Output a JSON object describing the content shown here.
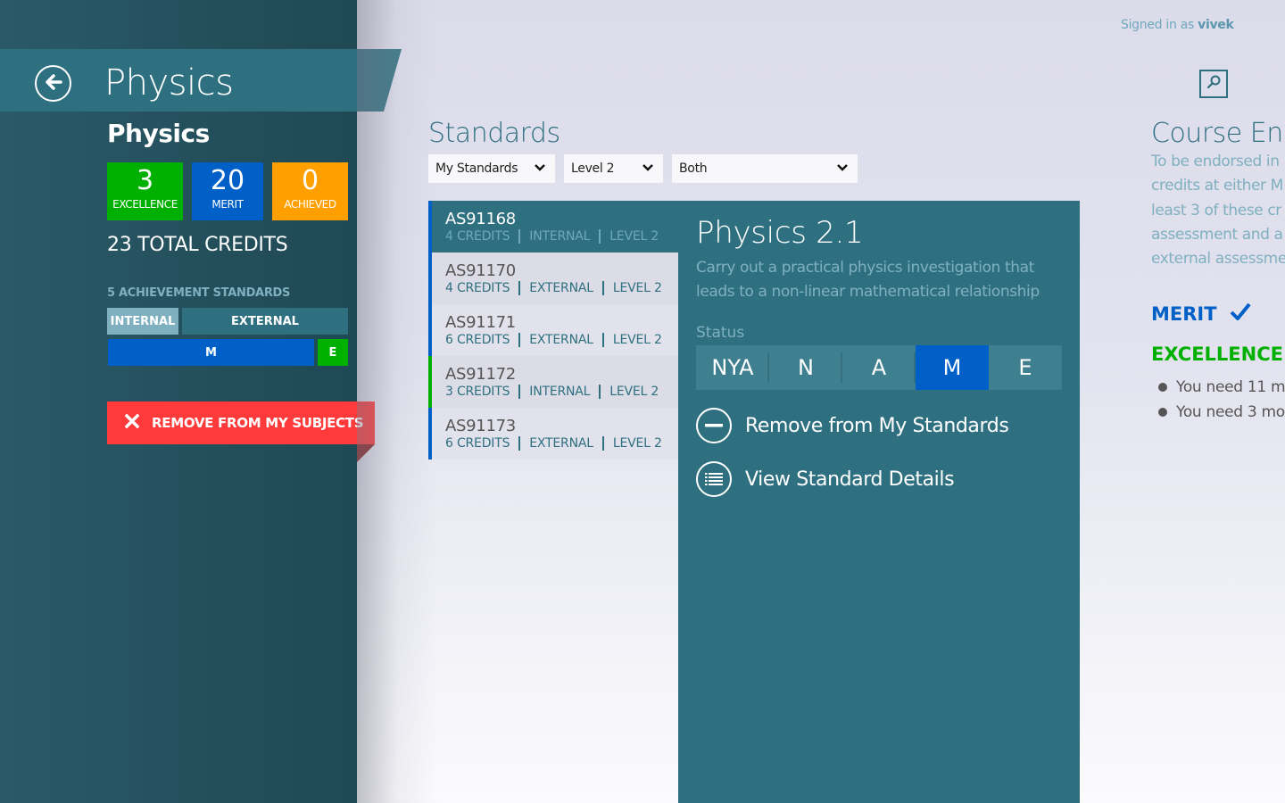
{
  "header": {
    "signed_in_prefix": "Signed in as",
    "username": "vivek",
    "search_icon": "search-icon"
  },
  "sidebar": {
    "banner_title": "Physics",
    "back_icon": "arrow-left-circle-icon",
    "subject_name": "Physics",
    "tiles": [
      {
        "value": "3",
        "label": "EXCELLENCE",
        "color": "#00b000"
      },
      {
        "value": "20",
        "label": "MERIT",
        "color": "#0060c8"
      },
      {
        "value": "0",
        "label": "ACHIEVED",
        "color": "#ff9f00"
      }
    ],
    "total_credits": "23 TOTAL CREDITS",
    "achievement_label": "5 ACHIEVEMENT STANDARDS",
    "type_bar": [
      {
        "label": "INTERNAL",
        "color": "#7fb0c0"
      },
      {
        "label": "EXTERNAL",
        "color": "#2f7080"
      }
    ],
    "grade_bar": [
      {
        "label": "M",
        "color": "#0060c8"
      },
      {
        "label": "E",
        "color": "#00b000"
      }
    ],
    "remove_button": "REMOVE FROM MY SUBJECTS",
    "remove_color": "#ff3a3a"
  },
  "standards": {
    "title": "Standards",
    "filters": [
      {
        "value": "My Standards"
      },
      {
        "value": "Level 2"
      },
      {
        "value": "Both"
      }
    ],
    "items": [
      {
        "code": "AS91168",
        "credits": "4 CREDITS",
        "type": "INTERNAL",
        "level": "LEVEL 2",
        "selected": true
      },
      {
        "code": "AS91170",
        "credits": "4 CREDITS",
        "type": "EXTERNAL",
        "level": "LEVEL 2"
      },
      {
        "code": "AS91171",
        "credits": "6 CREDITS",
        "type": "EXTERNAL",
        "level": "LEVEL 2"
      },
      {
        "code": "AS91172",
        "credits": "3 CREDITS",
        "type": "INTERNAL",
        "level": "LEVEL 2"
      },
      {
        "code": "AS91173",
        "credits": "6 CREDITS",
        "type": "EXTERNAL",
        "level": "LEVEL 2"
      }
    ]
  },
  "detail": {
    "title": "Physics 2.1",
    "description": "Carry out a practical physics investigation that leads to a non-linear mathematical relationship",
    "status_label": "Status",
    "status_options": [
      "NYA",
      "N",
      "A",
      "M",
      "E"
    ],
    "status_selected": "M",
    "actions": [
      {
        "label": "Remove from My Standards",
        "icon": "minus-circle-icon"
      },
      {
        "label": "View Standard Details",
        "icon": "list-circle-icon"
      }
    ]
  },
  "endorsement": {
    "title": "Course End",
    "description_lines": [
      "To be endorsed in",
      "credits at either M",
      "least 3 of these cr",
      "assessment and a",
      "external assessme"
    ],
    "merit_label": "MERIT",
    "merit_achieved": true,
    "excellence_label": "EXCELLENCE",
    "bullets": [
      "You need 11 m",
      "You need 3 mo"
    ]
  }
}
